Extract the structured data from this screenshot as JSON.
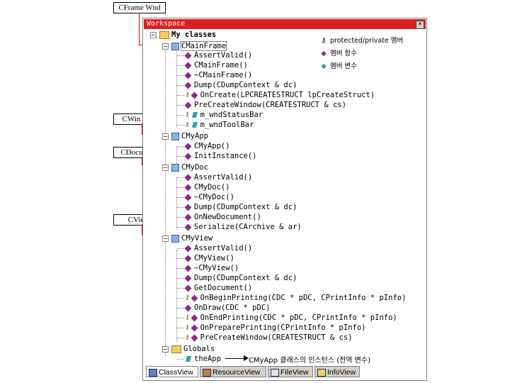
{
  "callouts": {
    "frame": "CFrame Wnd",
    "winapp": "CWin App",
    "document": "CDocument",
    "view": "CView"
  },
  "window": {
    "title": "Workspace",
    "close": "×"
  },
  "legend": {
    "protected": "protected/private 멤버",
    "function": "멤버 함수",
    "variable": "멤버 변수"
  },
  "tree": {
    "root": "My classes",
    "cmainframe": "CMainFrame",
    "mf_items": [
      "AssertValid()",
      "CMainFrame()",
      "~CMainFrame()",
      "Dump(CDumpContext & dc)",
      "OnCreate(LPCREATESTRUCT lpCreateStruct)",
      "PreCreateWindow(CREATESTRUCT & cs)",
      "m_wndStatusBar",
      "m_wndToolBar"
    ],
    "cmyapp": "CMyApp",
    "app_items": [
      "CMyApp()",
      "InitInstance()"
    ],
    "cmydoc": "CMyDoc",
    "doc_items": [
      "AssertValid()",
      "CMyDoc()",
      "~CMyDoc()",
      "Dump(CDumpContext & dc)",
      "OnNewDocument()",
      "Serialize(CArchive & ar)"
    ],
    "cmyview": "CMyView",
    "view_items": [
      "AssertValid()",
      "CMyView()",
      "~CMyView()",
      "Dump(CDumpContext & dc)",
      "GetDocument()",
      "OnBeginPrinting(CDC * pDC, CPrintInfo * pInfo)",
      "OnDraw(CDC * pDC)",
      "OnEndPrinting(CDC * pDC, CPrintInfo * pInfo)",
      "OnPreparePrinting(CPrintInfo * pInfo)",
      "PreCreateWindow(CREATESTRUCT & cs)"
    ],
    "globals": "Globals",
    "theapp": "theApp"
  },
  "annotation": "CMyApp 클래스의 인스턴스 (전역 변수)",
  "tabs": [
    "ClassView",
    "ResourceView",
    "FileView",
    "InfoView"
  ],
  "colors": {
    "titlebar": "#e02020",
    "callout_line": "#cc0000",
    "function_icon": "#8a2a8a",
    "variable_icon": "#30a0a0"
  }
}
